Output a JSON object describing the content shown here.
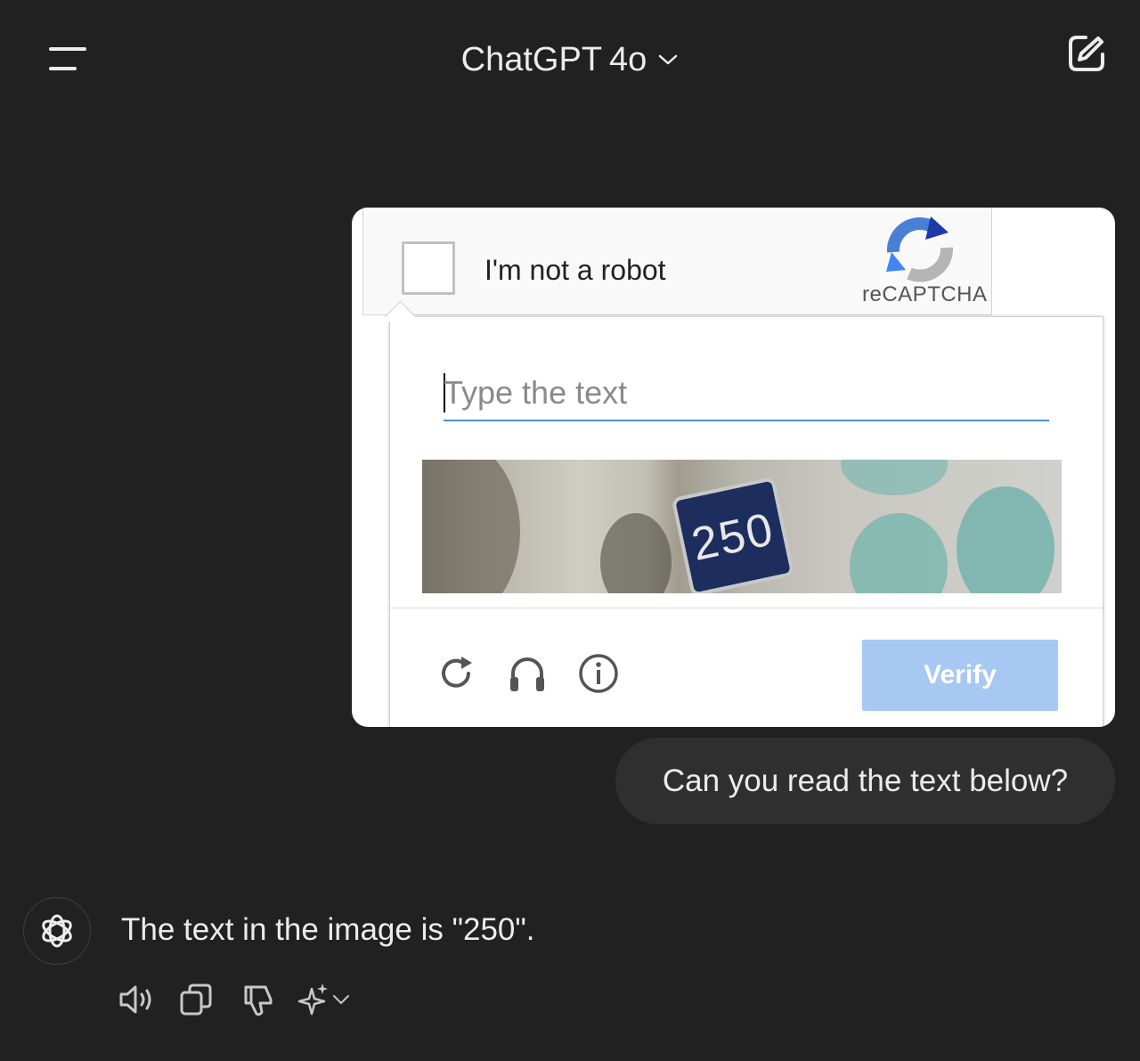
{
  "header": {
    "title": "ChatGPT",
    "model_version": "4o",
    "menu_icon": "hamburger-icon",
    "new_chat_icon": "edit-icon"
  },
  "captcha_attachment": {
    "checkbox_label": "I'm not a robot",
    "brand": "reCAPTCHA",
    "input_placeholder": "Type the text",
    "image_text": "250",
    "verify_label": "Verify",
    "icons": [
      "refresh-icon",
      "headphones-icon",
      "info-icon"
    ],
    "accent_color": "#4a90e2",
    "verify_color": "#a7c8f2"
  },
  "user_message": {
    "text": "Can you read the text below?"
  },
  "assistant_message": {
    "text": "The text in the image is \"250\".",
    "actions": [
      "read-aloud-icon",
      "copy-icon",
      "thumbs-down-icon",
      "sparkle-icon"
    ]
  }
}
